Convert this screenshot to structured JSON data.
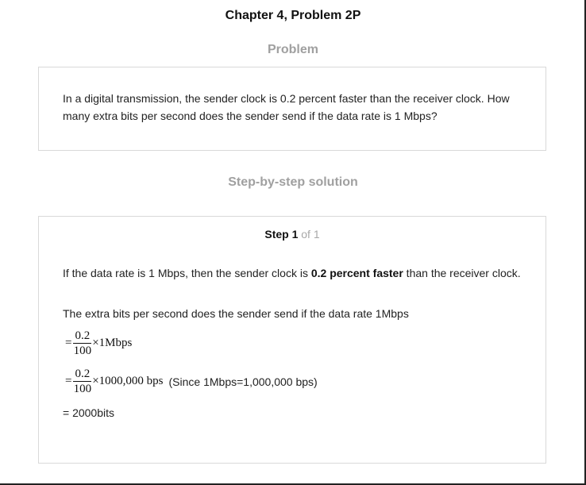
{
  "header": {
    "chapter_title": "Chapter 4, Problem 2P"
  },
  "problem": {
    "heading": "Problem",
    "text": "In a digital transmission, the sender clock is 0.2 percent faster than the receiver clock. How many extra bits per second does the sender send if the data rate is 1 Mbps?"
  },
  "solution": {
    "heading": "Step-by-step solution",
    "step_word": "Step 1",
    "step_of": " of 1",
    "para1_before": "If the data rate is 1 Mbps, then the sender clock is ",
    "para1_bold": "0.2 percent faster",
    "para1_after": " than the receiver clock.",
    "para2": "The extra bits per second does the sender send if the data rate 1Mbps",
    "eq1": {
      "eq_sign": "=",
      "numerator": "0.2",
      "denominator": "100",
      "tail": "×1Mbps"
    },
    "eq2": {
      "eq_sign": "=",
      "numerator": "0.2",
      "denominator": "100",
      "tail": "×1000,000 bps",
      "note": "(Since 1Mbps=1,000,000 bps)"
    },
    "result": "= 2000bits"
  }
}
